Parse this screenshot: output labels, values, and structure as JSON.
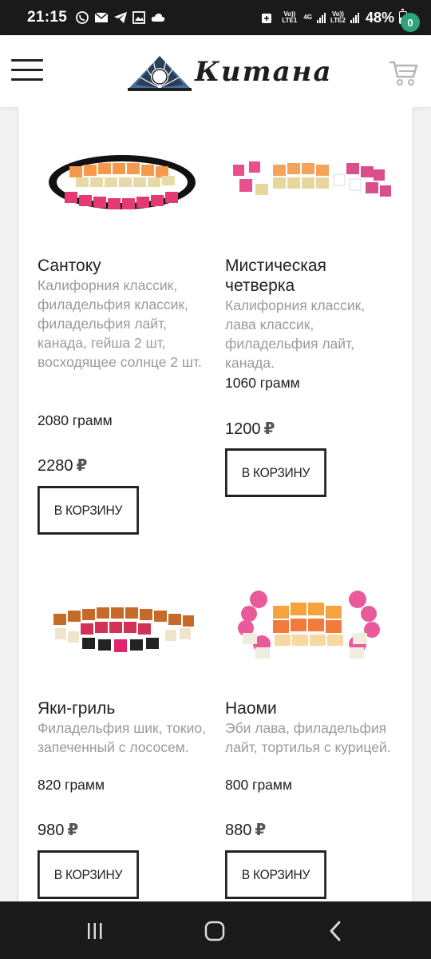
{
  "status_bar": {
    "time": "21:15",
    "net1_top": "Vo))",
    "net1_bottom": "LTE1",
    "net_gen": "4G",
    "net2_top": "Vo))",
    "net2_bottom": "LTE2",
    "battery": "48%",
    "battery_level": 0.48
  },
  "header": {
    "logo_text": "Китана",
    "cart_count": "0",
    "accent_color": "#2fa37a"
  },
  "products": [
    {
      "name": "Сантоку",
      "description": "Калифорния классик, филадельфия классик, филадельфия лайт, канада, гейша 2 шт, восходящее солнце 2 шт.",
      "weight": "2080 грамм",
      "price": "2280",
      "currency": "₽",
      "button": "В КОРЗИНУ"
    },
    {
      "name": "Мистическая четверка",
      "description": "Калифорния классик, лава классик, филадельфия лайт, канада.",
      "weight": "1060 грамм",
      "price": "1200",
      "currency": "₽",
      "button": "В КОРЗИНУ"
    },
    {
      "name": "Яки-гриль",
      "description": "Филадельфия шик, токио, запеченный с лососем.",
      "weight": "820 грамм",
      "price": "980",
      "currency": "₽",
      "button": "В КОРЗИНУ"
    },
    {
      "name": "Наоми",
      "description": "Эби лава, филадельфия лайт, тортилья с курицей.",
      "weight": "800 грамм",
      "price": "880",
      "currency": "₽",
      "button": "В КОРЗИНУ"
    }
  ]
}
